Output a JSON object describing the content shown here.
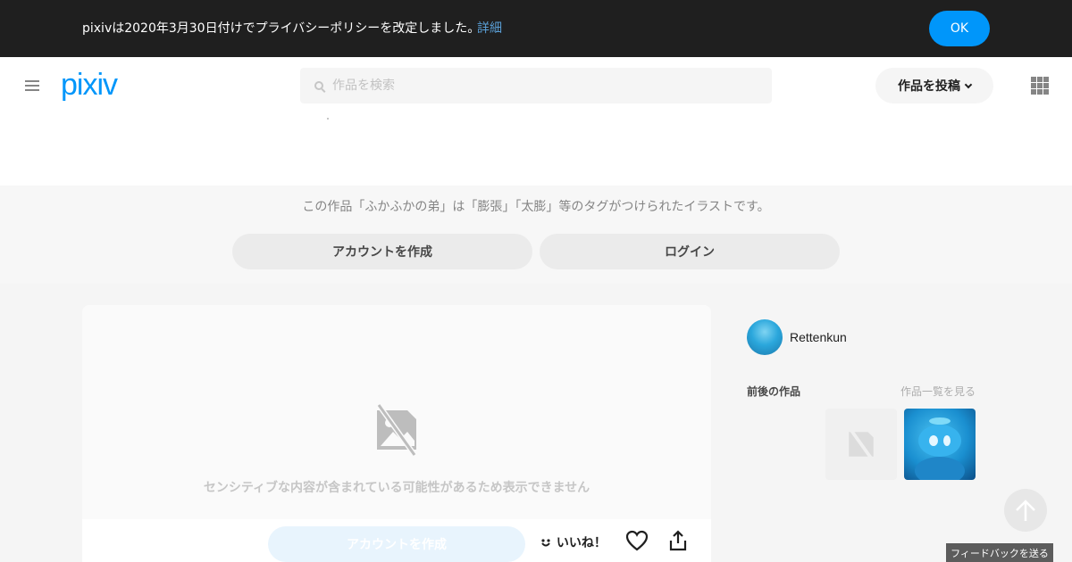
{
  "banner": {
    "message": "pixivは2020年3月30日付けでプライバシーポリシーを改定しました。",
    "details_link": "詳細",
    "ok_button": "OK"
  },
  "header": {
    "logo": "pixiv",
    "search_placeholder": "作品を検索",
    "post_button": "作品を投稿",
    "icons": [
      "menu-icon",
      "search-icon",
      "chevron-down-icon",
      "apps-grid-icon"
    ]
  },
  "info": {
    "description": "この作品「ふかふかの弟」は「膨張」「太膨」等のタグがつけられたイラストです。",
    "create_account": "アカウントを作成",
    "login": "ログイン"
  },
  "artwork": {
    "sensitive_message": "センシティブな内容が含まれている可能性があるため表示できません",
    "create_account": "アカウントを作成",
    "like_label": "いいね！",
    "icons": [
      "hidden-image-icon",
      "smile-icon",
      "heart-icon",
      "share-icon"
    ]
  },
  "sidebar": {
    "username": "Rettenkun",
    "works_title": "前後の作品",
    "see_all_link": "作品一覧を見る"
  },
  "footer": {
    "feedback_button": "フィードバックを送る"
  },
  "colors": {
    "accent": "#0096fa",
    "banner_bg": "#1f1f1f",
    "page_bg": "#f5f5f5"
  }
}
